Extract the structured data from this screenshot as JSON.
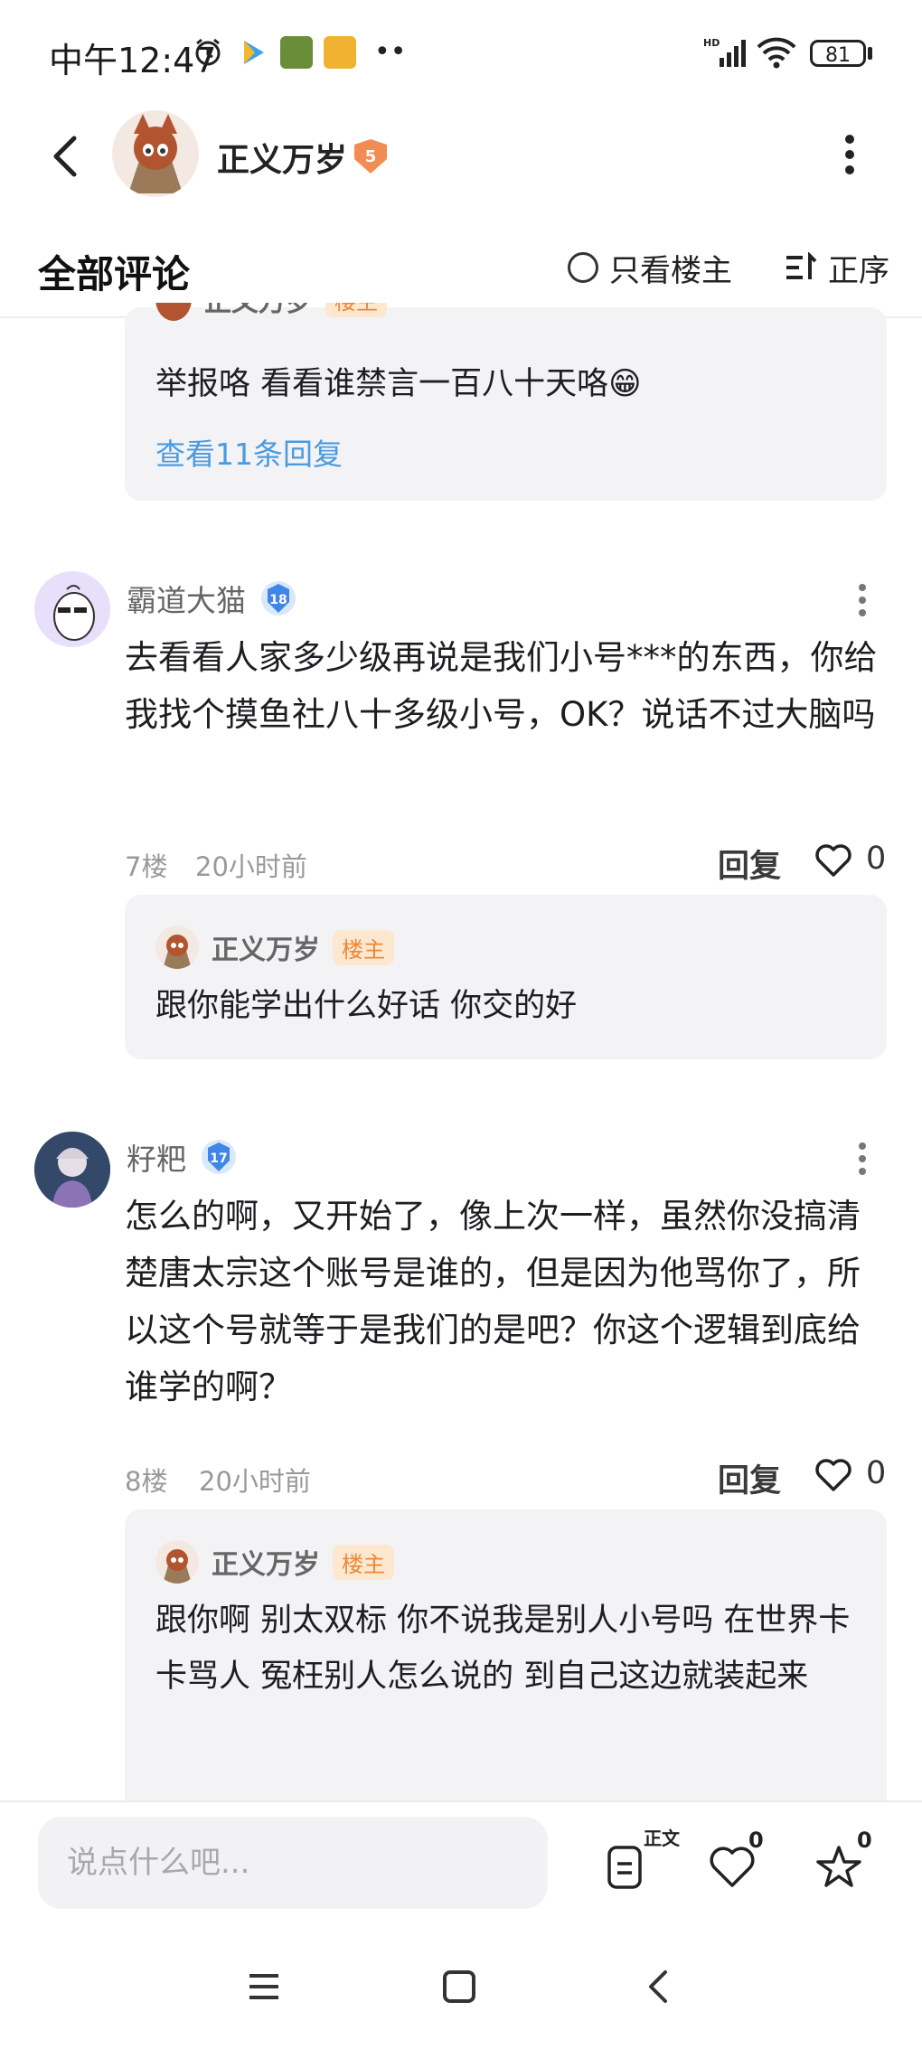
{
  "status": {
    "time": "中午12:47",
    "battery": "81"
  },
  "header": {
    "author": "正义万岁",
    "level": "5"
  },
  "tabs": {
    "title": "全部评论",
    "only_owner": "只看楼主",
    "order": "正序"
  },
  "top_reply": {
    "name": "正义万岁",
    "tag": "楼主",
    "text": "举报咯 看看谁禁言一百八十天咯😁",
    "more": "查看11条回复"
  },
  "comments": [
    {
      "name": "霸道大猫",
      "level": "18",
      "text": "去看看人家多少级再说是我们小号***的东西，你给我找个摸鱼社八十多级小号，OK？说话不过大脑吗",
      "floor": "7楼",
      "time": "20小时前",
      "reply_label": "回复",
      "likes": "0",
      "reply": {
        "name": "正义万岁",
        "tag": "楼主",
        "text": "跟你能学出什么好话 你交的好"
      }
    },
    {
      "name": "籽粑",
      "level": "17",
      "text": "怎么的啊，又开始了，像上次一样，虽然你没搞清楚唐太宗这个账号是谁的，但是因为他骂你了，所以这个号就等于是我们的是吧？你这个逻辑到底给谁学的啊？",
      "floor": "8楼",
      "time": "20小时前",
      "reply_label": "回复",
      "likes": "0",
      "reply": {
        "name": "正义万岁",
        "tag": "楼主",
        "text": "跟你啊 别太双标 你不说我是别人小号吗 在世界卡卡骂人 冤枉别人怎么说的 到自己这边就装起来"
      }
    }
  ],
  "bottom": {
    "placeholder": "说点什么吧...",
    "body_tag": "正文",
    "like_count": "0",
    "fav_count": "0"
  }
}
